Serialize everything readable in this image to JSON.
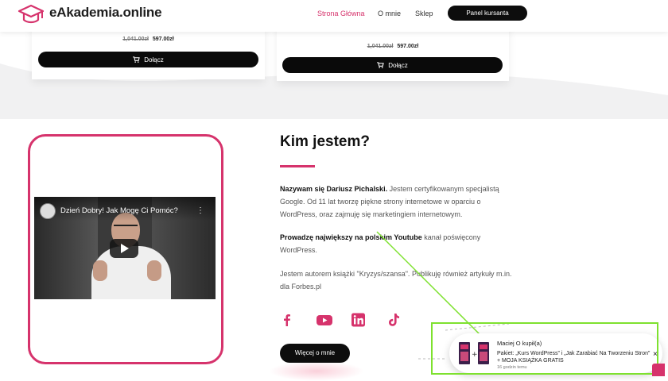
{
  "header": {
    "logo_text": "eAkademia.online",
    "nav": [
      {
        "label": "Strona Główna",
        "active": true
      },
      {
        "label": "O mnie",
        "active": false
      },
      {
        "label": "Sklep",
        "active": false
      }
    ],
    "panel_button": "Panel kursanta"
  },
  "products": [
    {
      "old_price": "1,041.00zł",
      "price": "597.00zł",
      "button": "Dołącz"
    },
    {
      "old_price": "1,041.00zł",
      "price": "597.00zł",
      "button": "Dołącz"
    }
  ],
  "video": {
    "title": "Dzień Dobry! Jak Mogę Ci Pomóc?",
    "menu_icon": "⋮"
  },
  "about": {
    "title": "Kim jestem?",
    "p1_bold": "Nazywam się Dariusz Pichalski.",
    "p1_text": " Jestem certyfikowanym specjalistą Google. Od 11 lat tworzę piękne strony internetowe w oparciu o WordPress, oraz zajmuję się marketingiem internetowym.",
    "p2_bold": "Prowadzę największy na polskim Youtube",
    "p2_text": " kanał poświęcony WordPress.",
    "p3_text": "Jestem autorem książki \"Kryzys/szansa\". Publikuję również artykuły m.in. dla Forbes.pl",
    "more_button": "Więcej o mnie",
    "social": [
      "facebook-icon",
      "youtube-icon",
      "linkedin-icon",
      "tiktok-icon"
    ]
  },
  "notification": {
    "buyer": "Maciej O kupił(a)",
    "description": "Pakiet: „Kurs WordPress” i „Jak Zarabiać Na Tworzeniu Stron” + MOJA KSIĄŻKA GRATIS",
    "time": "16 godzin temu",
    "close": "×"
  },
  "colors": {
    "accent": "#d6336c",
    "annotation": "#7ee12f"
  }
}
